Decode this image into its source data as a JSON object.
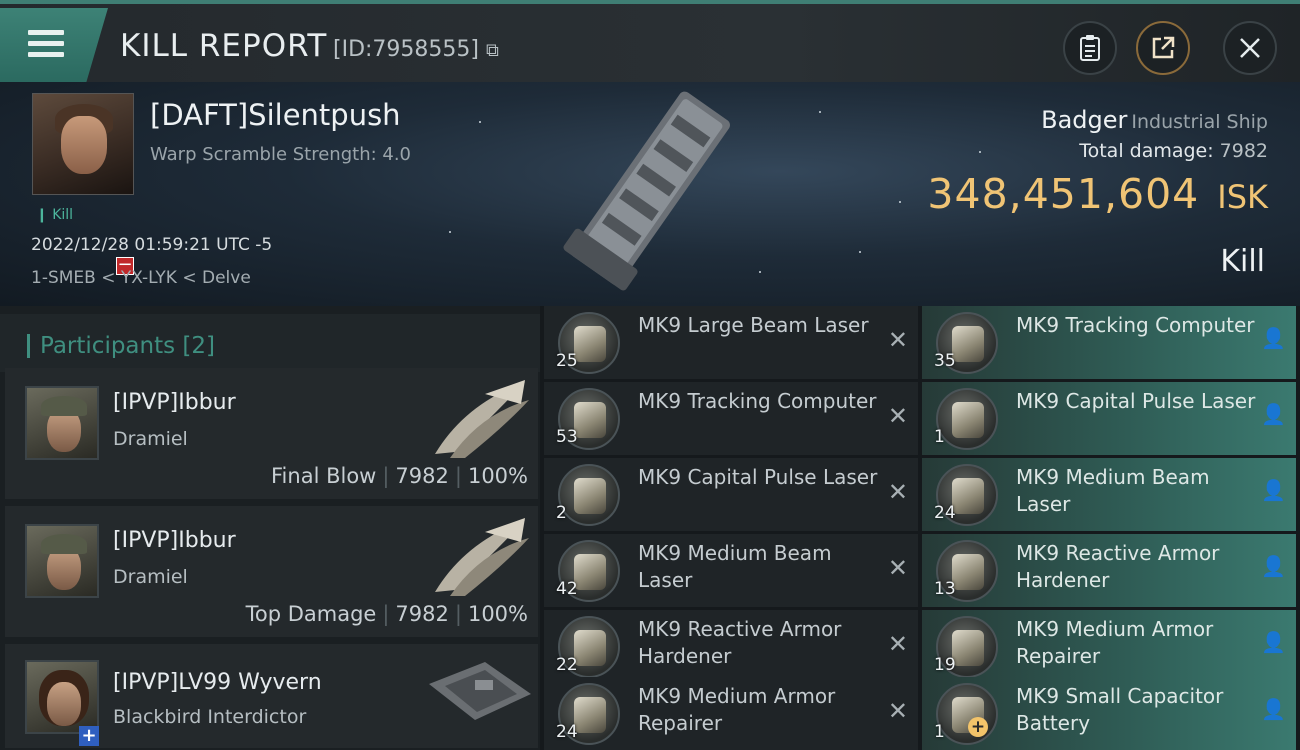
{
  "topbar": {
    "title": "KILL REPORT",
    "kill_id": "[ID:7958555]",
    "copy_icon": "copy-icon",
    "clipboard_icon": "clipboard-icon",
    "share_icon": "share-icon",
    "close_icon": "close-icon",
    "menu_icon": "hamburger-menu-icon"
  },
  "victim": {
    "name": "[DAFT]Silentpush",
    "scramble": "Warp Scramble Strength: 4.0",
    "tag": "Kill",
    "timestamp": "2022/12/28 01:59:21 UTC -5",
    "location": "1-SMEB < YX-LYK < Delve",
    "ship_name": "Badger",
    "ship_class": "Industrial Ship",
    "damage_label": "Total damage:",
    "damage_value": "7982",
    "isk_value": "348,451,604",
    "isk_unit": "ISK",
    "result": "Kill"
  },
  "participants": {
    "title": "Participants",
    "count": "[2]",
    "rows": [
      {
        "name": "[IPVP]Ibbur",
        "ship": "Dramiel",
        "role": "Final Blow",
        "damage": "7982",
        "percent": "100%"
      },
      {
        "name": "[IPVP]Ibbur",
        "ship": "Dramiel",
        "role": "Top Damage",
        "damage": "7982",
        "percent": "100%"
      },
      {
        "name": "[IPVP]LV99 Wyvern",
        "ship": "Blackbird Interdictor"
      }
    ]
  },
  "items_destroyed": [
    {
      "qty": "25",
      "name": "MK9 Large Beam Laser"
    },
    {
      "qty": "53",
      "name": "MK9 Tracking Computer"
    },
    {
      "qty": "2",
      "name": "MK9 Capital Pulse Laser"
    },
    {
      "qty": "42",
      "name": "MK9 Medium Beam Laser"
    },
    {
      "qty": "22",
      "name": "MK9 Reactive Armor Hardener"
    },
    {
      "qty": "24",
      "name": "MK9 Medium Armor Repairer"
    }
  ],
  "items_dropped": [
    {
      "qty": "35",
      "name": "MK9 Tracking Computer"
    },
    {
      "qty": "1",
      "name": "MK9 Capital Pulse Laser"
    },
    {
      "qty": "24",
      "name": "MK9 Medium Beam Laser"
    },
    {
      "qty": "13",
      "name": "MK9 Reactive Armor Hardener"
    },
    {
      "qty": "19",
      "name": "MK9 Medium Armor Repairer"
    },
    {
      "qty": "1",
      "name": "MK9 Small Capacitor Battery"
    }
  ],
  "marks": {
    "destroyed": "✕",
    "dropped": "person-icon"
  },
  "colors": {
    "accent": "#3f8f80",
    "isk": "#f0c475",
    "danger": "#c0282a"
  }
}
